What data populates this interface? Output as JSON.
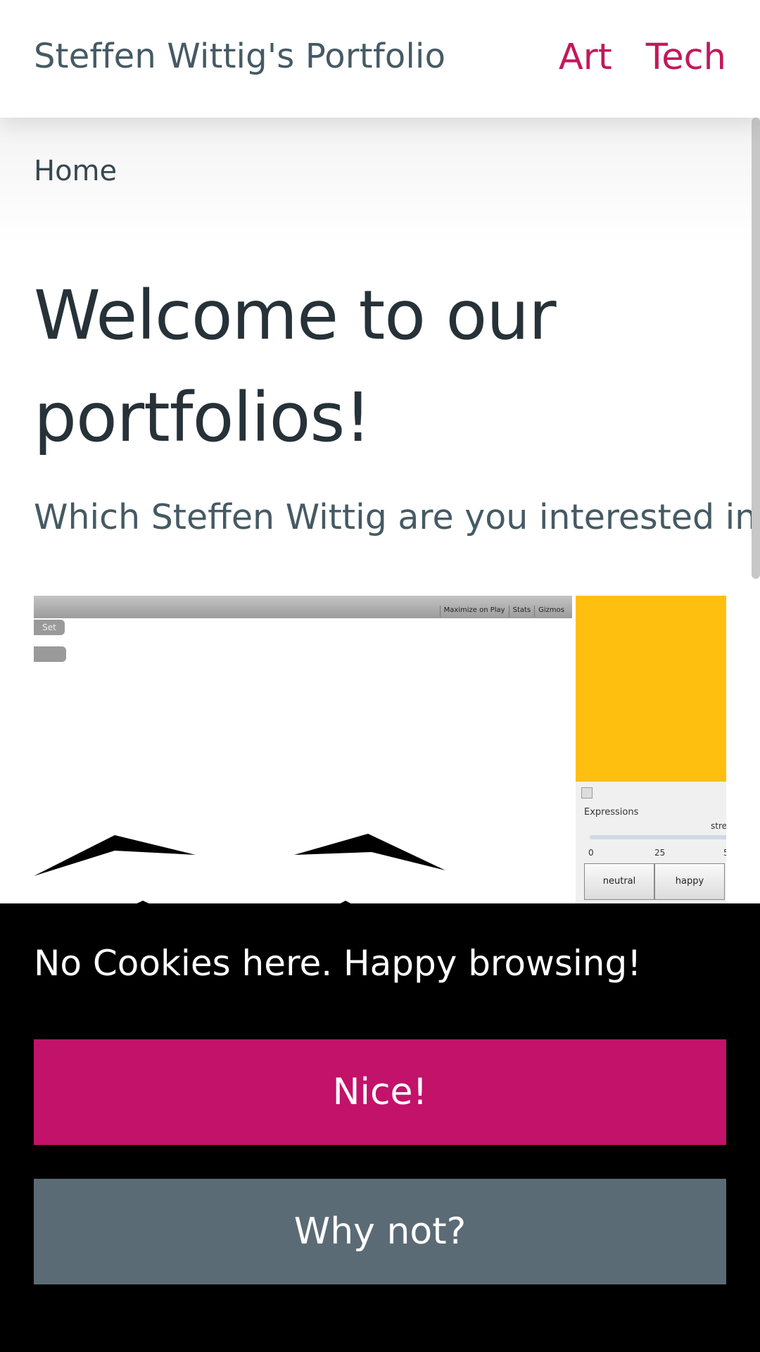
{
  "header": {
    "site_title": "Steffen Wittig's Portfolio",
    "nav": [
      "Art",
      "Tech"
    ]
  },
  "breadcrumb": "Home",
  "hero": {
    "title": "Welcome to our portfolios!",
    "subtitle": "Which Steffen Wittig are you interested in?"
  },
  "preview": {
    "toolbar": [
      "Maximize on Play",
      "Stats",
      "Gizmos"
    ],
    "set_button": "Set",
    "expressions": {
      "label": "Expressions",
      "slider_label": "stre",
      "ticks": [
        "0",
        "25",
        "5"
      ],
      "buttons": [
        "neutral",
        "happy"
      ]
    },
    "colors": {
      "panel_accent": "#ffbf0f"
    }
  },
  "cookie_banner": {
    "message": "No Cookies here. Happy browsing!",
    "accept_label": "Nice!",
    "decline_label": "Why not?"
  },
  "colors": {
    "brand": "#c2185b",
    "accept_button": "#c2126a",
    "decline_button": "#5b6b76",
    "banner_bg": "#000000"
  }
}
